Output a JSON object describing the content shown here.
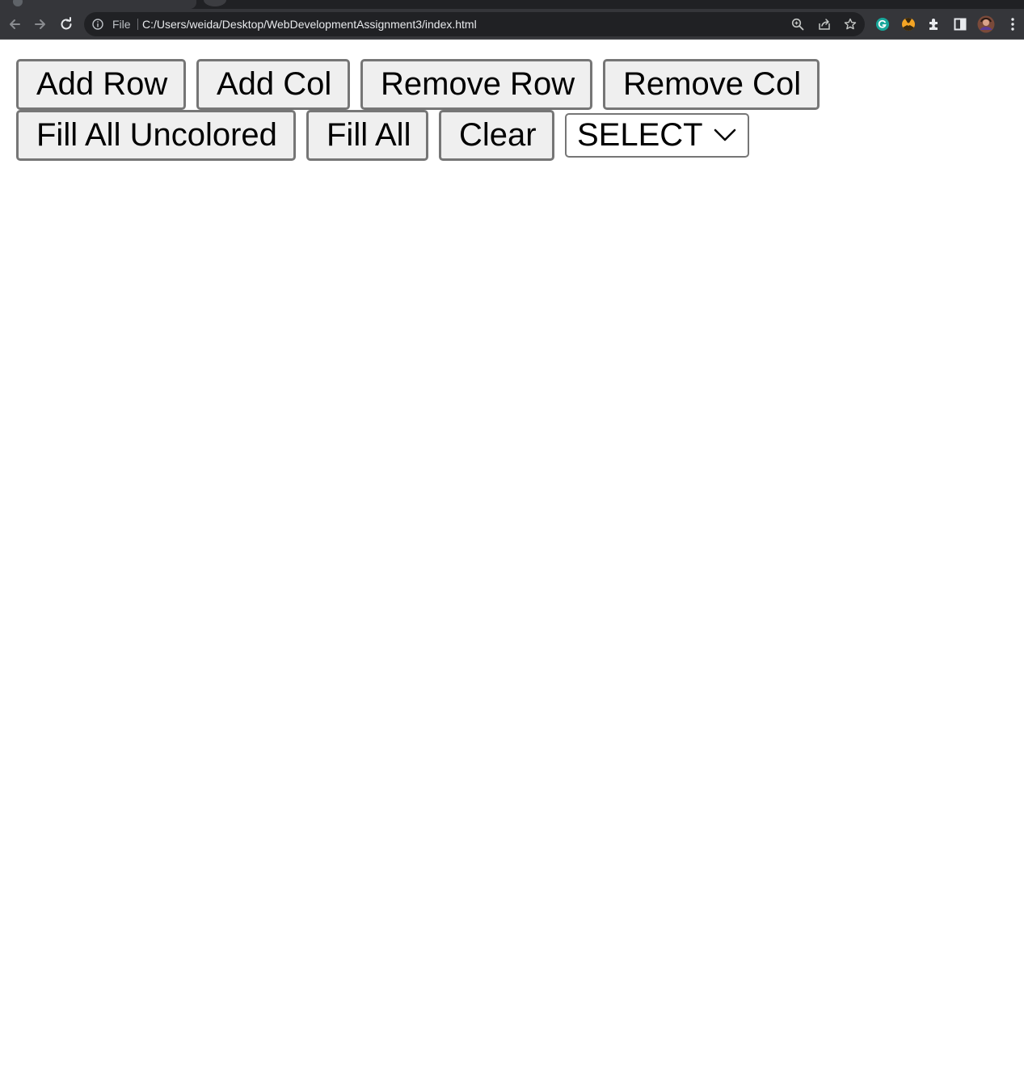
{
  "browser": {
    "address_scheme": "File",
    "address_url": "C:/Users/weida/Desktop/WebDevelopmentAssignment3/index.html",
    "icons": {
      "back": "back-arrow-icon",
      "forward": "forward-arrow-icon",
      "reload": "reload-icon",
      "site_info": "info-icon",
      "zoom": "zoom-icon",
      "share": "share-icon",
      "bookmark": "star-icon",
      "extension_grammarly": "grammarly-icon",
      "extension_radiation": "radiation-icon",
      "extensions": "puzzle-icon",
      "side_panel": "side-panel-icon",
      "profile": "avatar",
      "menu": "kebab-menu-icon"
    }
  },
  "controls": {
    "add_row": "Add Row",
    "add_col": "Add Col",
    "remove_row": "Remove Row",
    "remove_col": "Remove Col",
    "fill_all_uncolored": "Fill All Uncolored",
    "fill_all": "Fill All",
    "clear": "Clear",
    "color_select": {
      "selected": "SELECT"
    }
  },
  "colors": {
    "chrome_dark": "#202124",
    "chrome_toolbar": "#35363a",
    "button_bg": "#efefef",
    "button_border": "#767676"
  }
}
